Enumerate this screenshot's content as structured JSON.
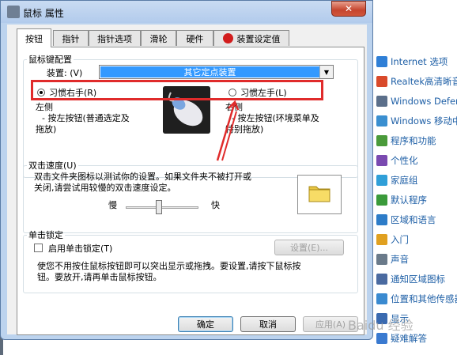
{
  "window": {
    "title": "鼠标 属性",
    "close_glyph": "✕"
  },
  "tabs": [
    {
      "label": "按钮",
      "active": true
    },
    {
      "label": "指针"
    },
    {
      "label": "指针选项"
    },
    {
      "label": "滑轮"
    },
    {
      "label": "硬件"
    },
    {
      "label": "装置设定值"
    }
  ],
  "button_config": {
    "group_label": "鼠标键配置",
    "device_label": "装置: (V)",
    "device_value": "其它定点装置",
    "right_hand_label": "习惯右手(R)",
    "left_hand_label": "习惯左手(L)",
    "right_hand_selected": true,
    "left_desc_title": "左侧",
    "left_desc_body_1": "- 按左按钮(普通选定及",
    "left_desc_body_2": "拖放)",
    "right_desc_title": "右侧",
    "right_desc_body_1": "- 按左按钮(环境菜单及",
    "right_desc_body_2": "特别拖放)"
  },
  "double_click": {
    "group_label": "双击速度(U)",
    "desc_1": "双击文件夹图标以测试你的设置。如果文件夹不被打开或",
    "desc_2": "关闭,请尝试用较慢的双击速度设定。",
    "slow_label": "慢",
    "fast_label": "快",
    "speed_fraction": 0.45
  },
  "click_lock": {
    "group_label": "单击锁定",
    "checkbox_label": "启用单击锁定(T)",
    "checked": false,
    "settings_button": "设置(E)...",
    "desc_1": "使您不用按住鼠标按钮即可以突出显示或拖拽。要设置,请按下鼠标按",
    "desc_2": "钮。要放开,请再单击鼠标按钮。"
  },
  "footer": {
    "ok": "确定",
    "cancel": "取消",
    "apply": "应用(A)"
  },
  "control_panel": {
    "items": [
      {
        "label": "Internet 选项",
        "icon": "globe-icon",
        "color": "#2f7fd6"
      },
      {
        "label": "Realtek高清晰音",
        "icon": "speaker-icon",
        "color": "#d94a2b"
      },
      {
        "label": "Windows Defen",
        "icon": "shield-icon",
        "color": "#5b6f8a"
      },
      {
        "label": "Windows 移动中",
        "icon": "mobility-icon",
        "color": "#3a8fd0"
      },
      {
        "label": "程序和功能",
        "icon": "programs-icon",
        "color": "#4a9a3a"
      },
      {
        "label": "个性化",
        "icon": "personalize-icon",
        "color": "#7a4ab0"
      },
      {
        "label": "家庭组",
        "icon": "homegroup-icon",
        "color": "#2f9fd8"
      },
      {
        "label": "默认程序",
        "icon": "default-programs-icon",
        "color": "#3a9a3a"
      },
      {
        "label": "区域和语言",
        "icon": "region-icon",
        "color": "#2d7cc8"
      },
      {
        "label": "入门",
        "icon": "getting-started-icon",
        "color": "#e0a020"
      },
      {
        "label": "声音",
        "icon": "sound-icon",
        "color": "#6a7a8a"
      },
      {
        "label": "通知区域图标",
        "icon": "notify-icon",
        "color": "#4a6aa0"
      },
      {
        "label": "位置和其他传感器",
        "icon": "location-icon",
        "color": "#3a8ad0"
      },
      {
        "label": "显示",
        "icon": "display-icon",
        "color": "#3a6ab0"
      },
      {
        "label": "疑难解答",
        "icon": "troubleshoot-icon",
        "color": "#3a7ad0"
      }
    ]
  },
  "watermark": "Baidu 经验"
}
